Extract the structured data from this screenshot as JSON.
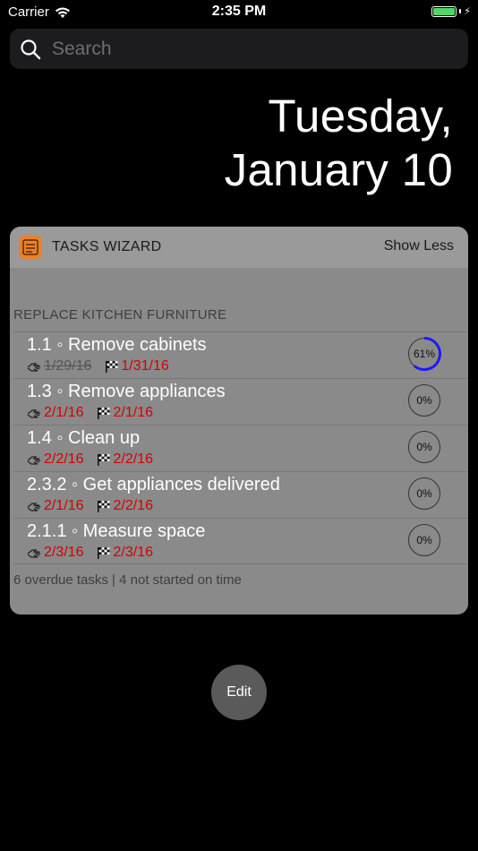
{
  "status_bar": {
    "carrier": "Carrier",
    "time": "2:35 PM",
    "icons": [
      "wifi-icon",
      "battery-icon",
      "charging-bolt-icon"
    ]
  },
  "search": {
    "placeholder": "Search",
    "icon": "search-icon"
  },
  "date": {
    "line1": "Tuesday,",
    "line2": "January 10"
  },
  "widget": {
    "app_name": "TASKS WIZARD",
    "show_less_label": "Show Less",
    "project_title": "REPLACE KITCHEN FURNITURE",
    "tasks": [
      {
        "title": "1.1 ◦ Remove cabinets",
        "start_date": "1/29/16",
        "start_done": true,
        "end_date": "1/31/16",
        "progress_label": "61%",
        "progress": 0.61
      },
      {
        "title": "1.3 ◦ Remove appliances",
        "start_date": "2/1/16",
        "start_done": false,
        "end_date": "2/1/16",
        "progress_label": "0%",
        "progress": 0
      },
      {
        "title": "1.4 ◦ Clean up",
        "start_date": "2/2/16",
        "start_done": false,
        "end_date": "2/2/16",
        "progress_label": "0%",
        "progress": 0
      },
      {
        "title": "2.3.2 ◦ Get appliances delivered",
        "start_date": "2/1/16",
        "start_done": false,
        "end_date": "2/2/16",
        "progress_label": "0%",
        "progress": 0
      },
      {
        "title": "2.1.1 ◦ Measure space",
        "start_date": "2/3/16",
        "start_done": false,
        "end_date": "2/3/16",
        "progress_label": "0%",
        "progress": 0
      }
    ],
    "footer": "6 overdue tasks | 4 not started on time"
  },
  "edit_label": "Edit",
  "colors": {
    "overdue": "#d50000",
    "progress": "#1a1aff",
    "battery": "#4cd964"
  }
}
